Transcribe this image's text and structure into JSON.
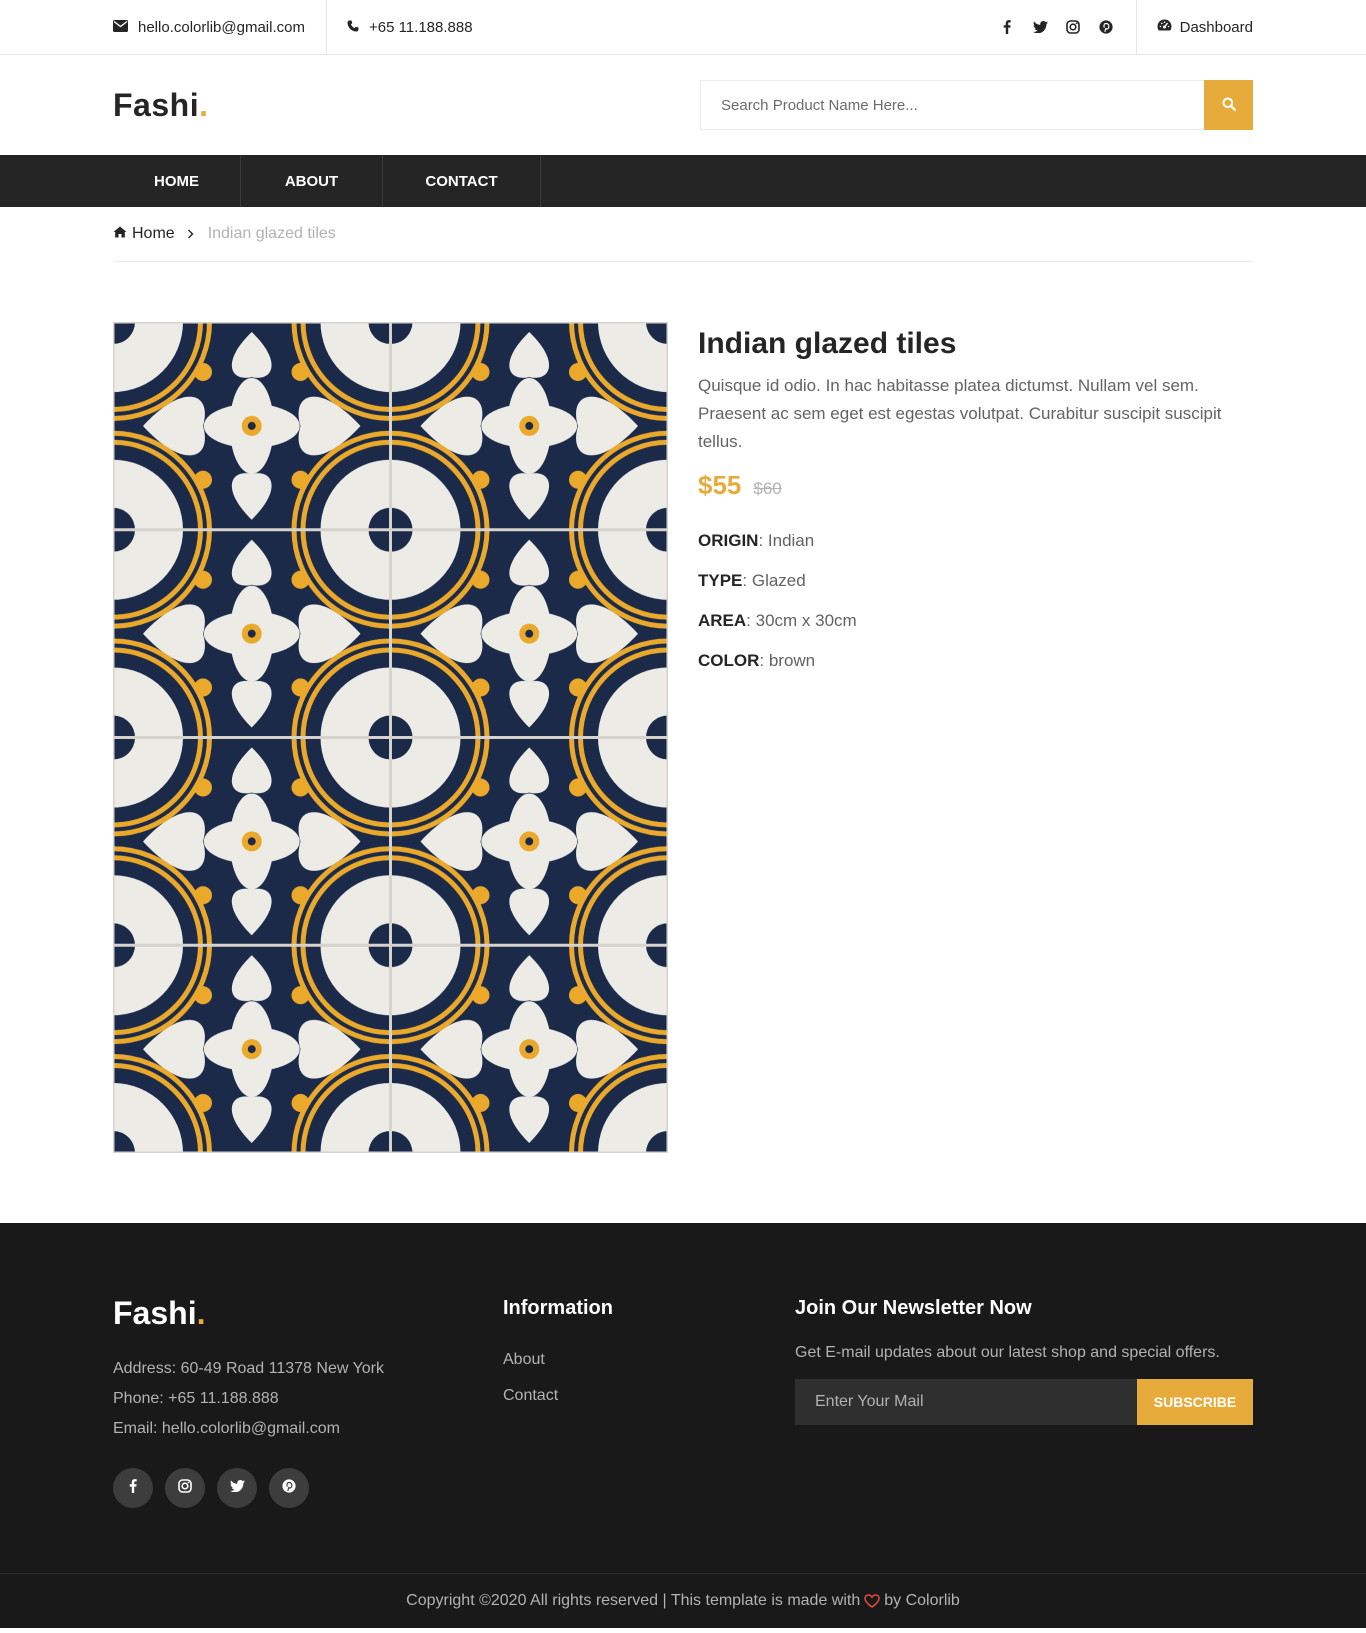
{
  "topbar": {
    "email": "hello.colorlib@gmail.com",
    "phone": "+65 11.188.888",
    "dashboard": "Dashboard",
    "social_icons": [
      "facebook-icon",
      "twitter-icon",
      "instagram-icon",
      "pinterest-icon"
    ]
  },
  "header": {
    "logo_text": "Fashi",
    "logo_dot": ".",
    "search_placeholder": "Search Product Name Here..."
  },
  "nav": {
    "items": [
      {
        "label": "HOME"
      },
      {
        "label": "ABOUT"
      },
      {
        "label": "CONTACT"
      }
    ]
  },
  "breadcrumb": {
    "home": "Home",
    "current": "Indian glazed tiles"
  },
  "product": {
    "title": "Indian glazed tiles",
    "description": "Quisque id odio. In hac habitasse platea dictumst. Nullam vel sem. Praesent ac sem eget est egestas volutpat. Curabitur suscipit suscipit tellus.",
    "price": "$55",
    "old_price": "$60",
    "specs": [
      {
        "key": "ORIGIN",
        "value": ": Indian"
      },
      {
        "key": "TYPE",
        "value": ": Glazed"
      },
      {
        "key": "AREA",
        "value": ": 30cm x 30cm"
      },
      {
        "key": "COLOR",
        "value": ": brown"
      }
    ],
    "image_colors": {
      "navy": "#1c2a4a",
      "yellow": "#eaa92a",
      "white": "#ecebe6"
    }
  },
  "footer": {
    "logo_text": "Fashi",
    "logo_dot": ".",
    "address": "Address: 60-49 Road 11378 New York",
    "phone": "Phone: +65 11.188.888",
    "email": "Email: hello.colorlib@gmail.com",
    "social_icons": [
      "facebook-icon",
      "instagram-icon",
      "twitter-icon",
      "pinterest-icon"
    ],
    "info_heading": "Information",
    "info_links": [
      "About",
      "Contact"
    ],
    "newsletter_heading": "Join Our Newsletter Now",
    "newsletter_text": "Get E-mail updates about our latest shop and special offers.",
    "newsletter_placeholder": "Enter Your Mail",
    "subscribe_label": "SUBSCRIBE",
    "copyright_before": "Copyright ©2020 All rights reserved | This template is made with",
    "copyright_after": "by Colorlib"
  },
  "colors": {
    "accent": "#e7ab3c",
    "dark": "#252525",
    "footer_bg": "#191919",
    "heart": "#e7443c"
  }
}
